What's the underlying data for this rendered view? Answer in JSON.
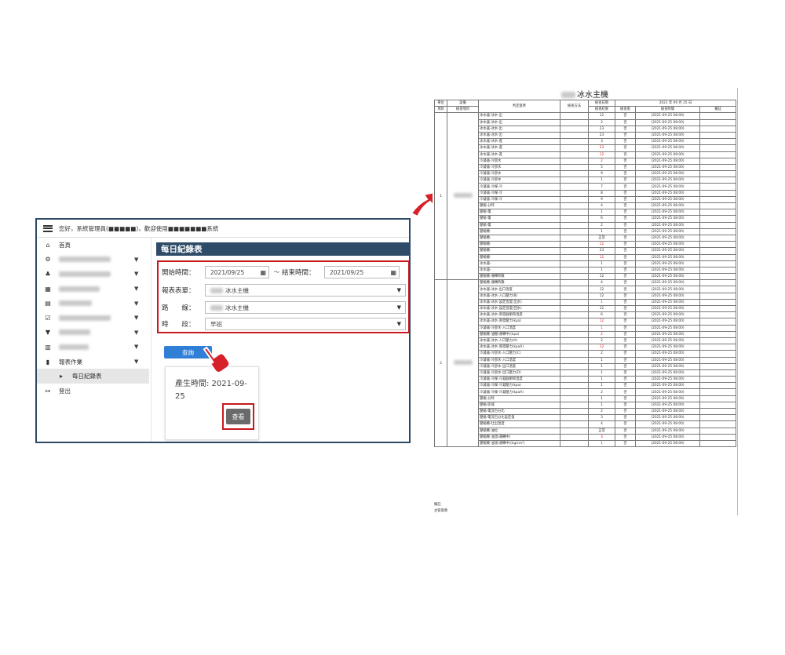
{
  "app": {
    "topbar_text": "您好，系統管理員(■■■■■)，歡迎使用■■■■■■■系統",
    "sidebar": [
      {
        "icon": "home-icon",
        "glyph": "⌂",
        "label": "首頁",
        "blurred": false,
        "caret": false
      },
      {
        "icon": "gear-icon",
        "glyph": "⚙",
        "label": "",
        "blurred": true,
        "caret": true,
        "bw": 66
      },
      {
        "icon": "sitemap-icon",
        "glyph": "♣",
        "label": "",
        "blurred": true,
        "caret": true,
        "bw": 66
      },
      {
        "icon": "calendar-icon",
        "glyph": "▦",
        "label": "",
        "blurred": true,
        "caret": true,
        "bw": 52
      },
      {
        "icon": "list-icon",
        "glyph": "▤",
        "label": "",
        "blurred": true,
        "caret": true,
        "bw": 42
      },
      {
        "icon": "check-square-icon",
        "glyph": "☑",
        "label": "",
        "blurred": true,
        "caret": true,
        "bw": 66
      },
      {
        "icon": "filter-icon",
        "glyph": "▼",
        "label": "",
        "blurred": true,
        "caret": true,
        "bw": 40
      },
      {
        "icon": "bar-chart-icon",
        "glyph": "▥",
        "label": "",
        "blurred": true,
        "caret": true,
        "bw": 38
      },
      {
        "icon": "file-icon",
        "glyph": "▮",
        "label": "報表作業",
        "blurred": false,
        "caret": true
      },
      {
        "icon": "caret-right-icon",
        "glyph": "▸",
        "label": "每日紀錄表",
        "blurred": false,
        "caret": false,
        "sub": true
      },
      {
        "icon": "logout-icon",
        "glyph": "↦",
        "label": "登出",
        "blurred": false,
        "caret": false
      }
    ],
    "page_title": "每日紀錄表",
    "form": {
      "start_label": "開始時間：",
      "start_value": "2021/09/25",
      "tilde": "～",
      "end_label": "結束時間：",
      "end_value": "2021/09/25",
      "report_label": "報表表單：",
      "report_value": "冰水主機",
      "route_label": "路　　線：",
      "route_value": "冰水主機",
      "shift_label": "時　　段：",
      "shift_value": "早班"
    },
    "query_button": "查詢",
    "card_text": "產生時間: 2021-09-25",
    "view_button": "查看"
  },
  "report": {
    "title": "冰水主機",
    "header1": [
      "單位",
      "設備",
      "判定基準",
      "檢查方法",
      "檢查日期",
      "2021 年 09 月 25 日"
    ],
    "header2": [
      "項目",
      "檢查項目",
      "檢查結果",
      "檢查者",
      "檢查時間",
      "備註"
    ],
    "time": "(2021-09-25 08:00)",
    "abnormal": "否",
    "group1_no": "1",
    "group2_no": "2",
    "group1": [
      {
        "item": "冰水器-冰水-出",
        "v": "12"
      },
      {
        "item": "冰水器-冰水-出",
        "v": "2"
      },
      {
        "item": "冰水器-冰水-出",
        "v": "23"
      },
      {
        "item": "冰水器-冰水-出",
        "v": "23"
      },
      {
        "item": "冰水器-冰水-進",
        "v": "3"
      },
      {
        "item": "冰水器-冰水-進",
        "v": "23",
        "red": true
      },
      {
        "item": "冰水器-冰水-進",
        "v": "12",
        "red": true
      },
      {
        "item": "冷凝器-冷卻水",
        "v": "2",
        "red": true
      },
      {
        "item": "冷凝器-冷卻水",
        "v": "5"
      },
      {
        "item": "冷凝器-冷卻水",
        "v": "9"
      },
      {
        "item": "冷凝器-冷卻水",
        "v": "1"
      },
      {
        "item": "冷凝器-冷媒-冷",
        "v": "7"
      },
      {
        "item": "冷凝器-冷媒-冷",
        "v": "8"
      },
      {
        "item": "冷凝器-冷媒-冷",
        "v": "9"
      },
      {
        "item": "壓縮-分時",
        "v": "4"
      },
      {
        "item": "壓縮-電",
        "v": "1"
      },
      {
        "item": "壓縮-電",
        "v": "6"
      },
      {
        "item": "壓縮-電",
        "v": "2"
      },
      {
        "item": "壓縮機-",
        "v": "1"
      },
      {
        "item": "壓縮機-",
        "v": "正常"
      },
      {
        "item": "壓縮機-",
        "v": "12",
        "red": true
      },
      {
        "item": "壓縮機-",
        "v": "23"
      },
      {
        "item": "壓縮機-",
        "v": "12",
        "red": true
      },
      {
        "item": "冰水器-",
        "v": "1"
      },
      {
        "item": "冰水器-",
        "v": "1"
      },
      {
        "item": "壓縮機-運轉時數",
        "v": "12"
      }
    ],
    "group2": [
      {
        "item": "壓縮機-運轉時數",
        "v": "4"
      },
      {
        "item": "冰水器-冰水-出口溫度",
        "v": "12"
      },
      {
        "item": "冰水器-冰水-入口壓力(B)",
        "v": "12"
      },
      {
        "item": "冰水器-冰水-設定溫度(出水)",
        "v": "1",
        "red": true
      },
      {
        "item": "冰水器-冰水-設定溫度(回水)",
        "v": "12"
      },
      {
        "item": "冰水器-冰水-蒸發器飽和溫度",
        "v": "6"
      },
      {
        "item": "冰水器-冰水-蒸發壓力(kpa)",
        "v": "12",
        "red": true
      },
      {
        "item": "冷凝器-冷卻水-入口溫度",
        "v": "1",
        "red": true
      },
      {
        "item": "壓縮機-油壓(運轉中)(kpa)",
        "v": "2",
        "red": true
      },
      {
        "item": "冰水器-冰水-入口壓力(A)",
        "v": "2"
      },
      {
        "item": "冰水器-冰水-蒸發壓力(kpaA)",
        "v": "12",
        "red": true
      },
      {
        "item": "冷凝器-冷卻水-入口壓力(C)",
        "v": "2"
      },
      {
        "item": "冷凝器-冷卻水-入口溫度",
        "v": "1"
      },
      {
        "item": "冷凝器-冷卻水-出口溫度",
        "v": "1"
      },
      {
        "item": "冷凝器-冷卻水-出口壓力(D)",
        "v": "1"
      },
      {
        "item": "冷凝器-冷媒-冷凝器飽和溫度",
        "v": "1"
      },
      {
        "item": "冷凝器-冷媒-冷凝壓力(kpa)",
        "v": "1"
      },
      {
        "item": "冷凝器-冷媒-冷凝壓力(kpaA)",
        "v": "2"
      },
      {
        "item": "壓縮-分時",
        "v": "1"
      },
      {
        "item": "壓縮-區域",
        "v": "1"
      },
      {
        "item": "壓縮-電流百分比",
        "v": "2"
      },
      {
        "item": "壓縮-電流百分比設定值",
        "v": "3"
      },
      {
        "item": "壓縮機-吐出溫度",
        "v": "4"
      },
      {
        "item": "壓縮機-油位",
        "v": "正常"
      },
      {
        "item": "壓縮機-油溫(運轉中)",
        "v": "3",
        "red": true
      },
      {
        "item": "壓縮機-油溫(運轉中)(kg/cm²)",
        "v": "1",
        "red": true
      }
    ],
    "footer1": "備註",
    "footer2": "主管簽章"
  }
}
